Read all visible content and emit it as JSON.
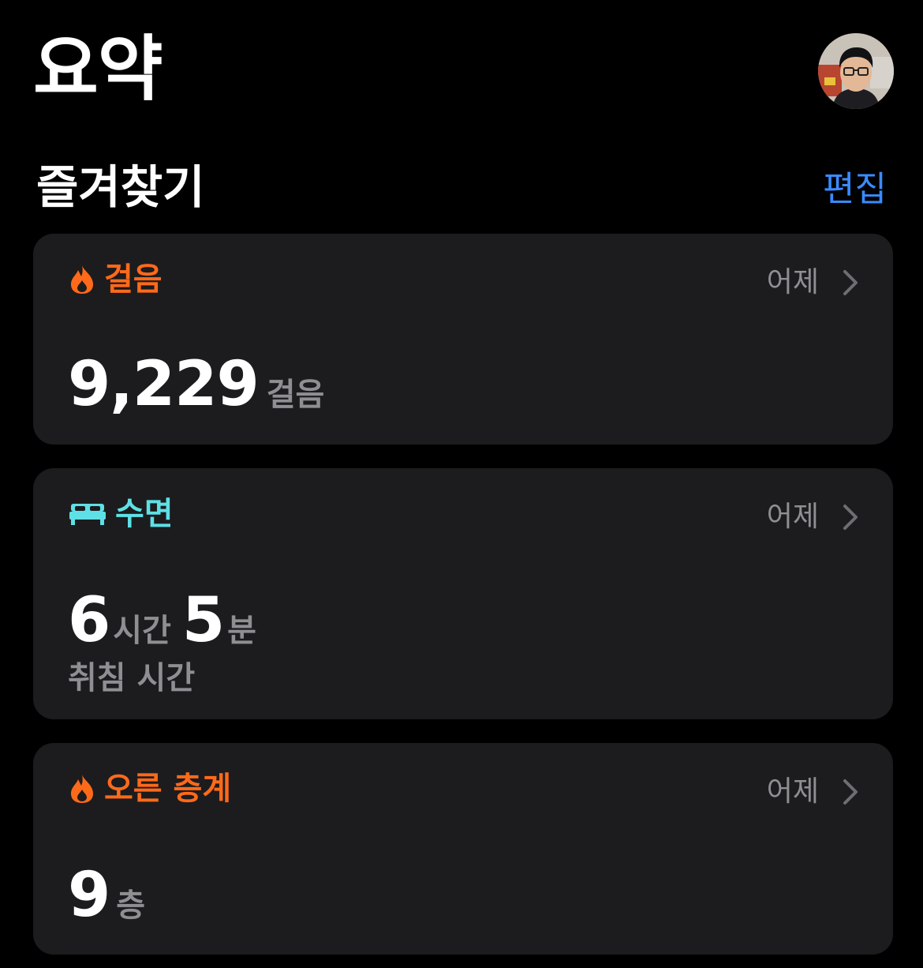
{
  "page": {
    "title": "요약"
  },
  "favorites": {
    "title": "즐겨찾기",
    "edit_label": "편집"
  },
  "cards": {
    "steps": {
      "label": "걸음",
      "icon": "flame-icon",
      "color": "#ff6a1a",
      "date": "어제",
      "value": "9,229",
      "unit": "걸음"
    },
    "sleep": {
      "label": "수면",
      "icon": "bed-icon",
      "color": "#5ee0e6",
      "date": "어제",
      "hours_value": "6",
      "hours_unit": "시간",
      "minutes_value": "5",
      "minutes_unit": "분",
      "caption": "취침 시간"
    },
    "floors": {
      "label": "오른 층계",
      "icon": "flame-icon",
      "color": "#ff6a1a",
      "date": "어제",
      "value": "9",
      "unit": "층"
    }
  },
  "colors": {
    "background": "#000000",
    "card": "#1c1c1e",
    "accent_link": "#3a8bff",
    "secondary_text": "#8e8e93"
  }
}
